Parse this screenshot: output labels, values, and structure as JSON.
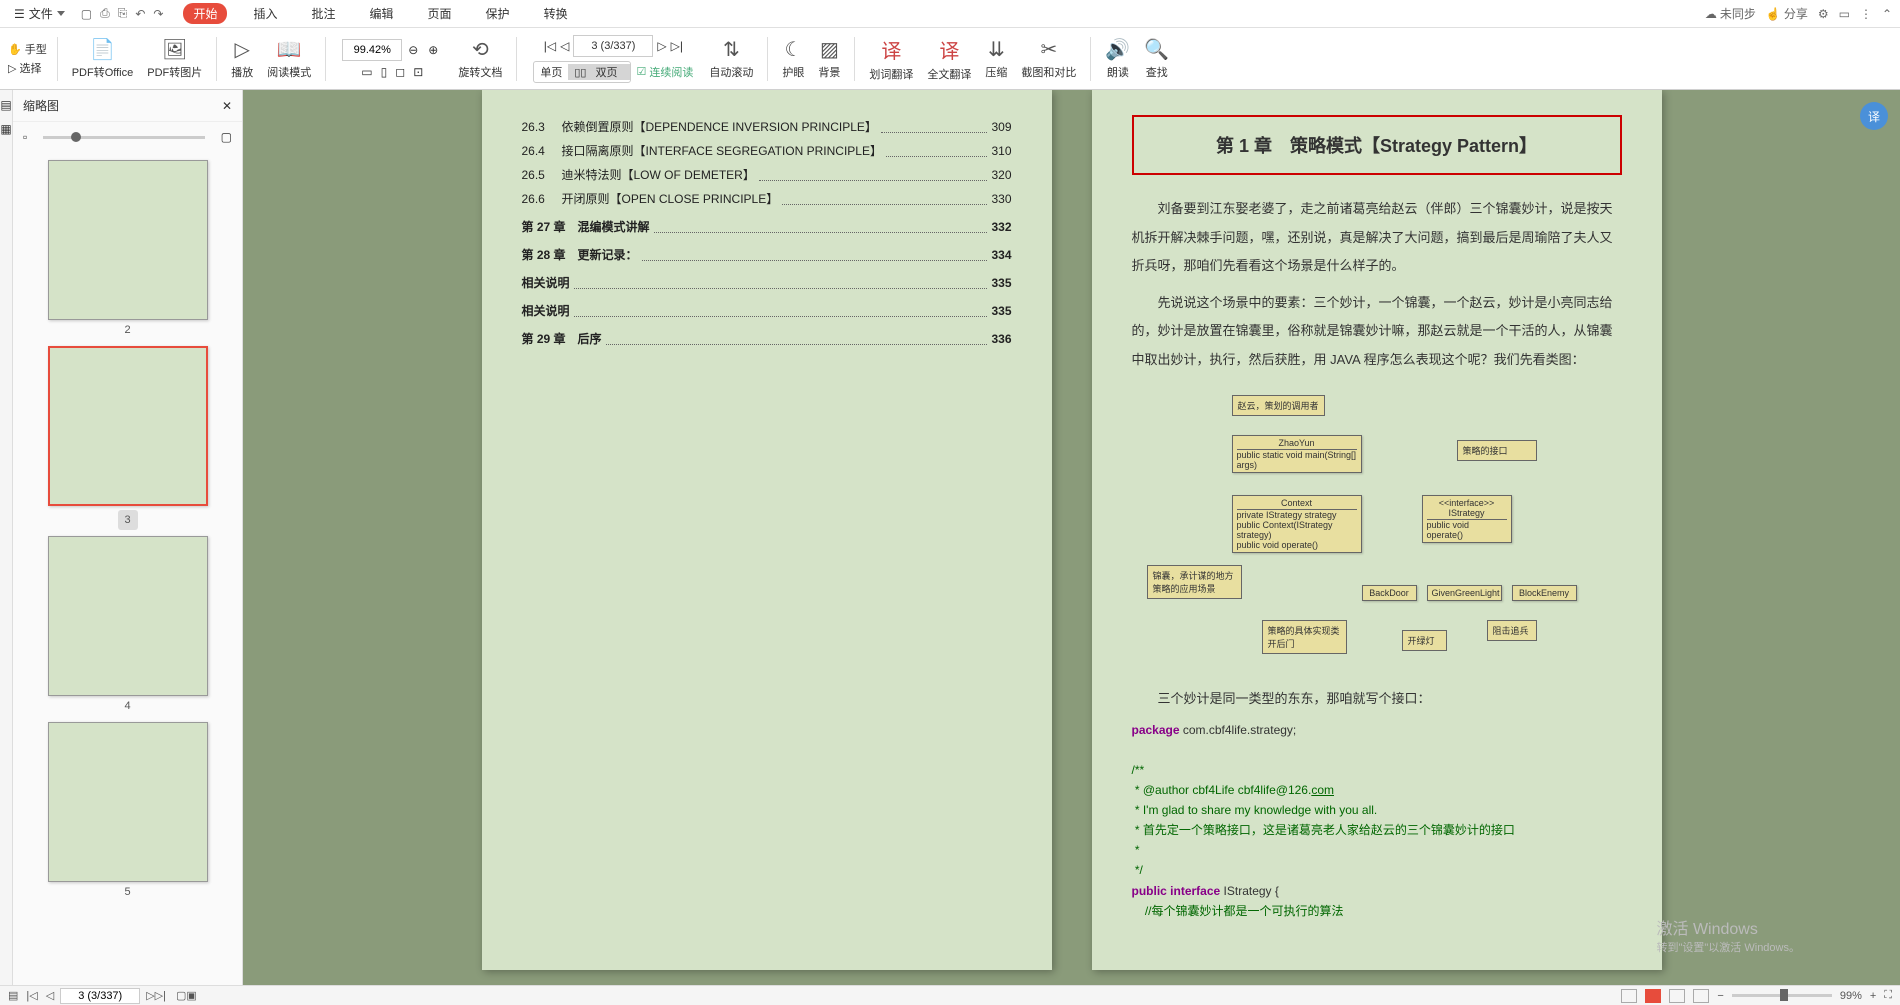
{
  "menu": {
    "file": "文件",
    "tabs": [
      "开始",
      "插入",
      "批注",
      "编辑",
      "页面",
      "保护",
      "转换"
    ]
  },
  "topright": {
    "sync": "未同步",
    "share": "分享"
  },
  "sidebar": {
    "hand": "手型",
    "select": "选择"
  },
  "tb": {
    "pdf_office": "PDF转Office",
    "pdf_img": "PDF转图片",
    "play": "播放",
    "read_mode": "阅读模式",
    "zoom": "99.42%",
    "page_info": "3 (3/337)",
    "rotate": "旋转文档",
    "single": "单页",
    "double": "双页",
    "cont_read": "连续阅读",
    "auto_scroll": "自动滚动",
    "bg": "背景",
    "word_trans": "划词翻译",
    "full_trans": "全文翻译",
    "compress": "压缩",
    "compare": "截图和对比",
    "read_aloud": "朗读",
    "find": "查找",
    "eye": "护眼"
  },
  "thumbs": {
    "title": "缩略图",
    "pages": [
      "2",
      "3",
      "4",
      "5"
    ]
  },
  "toc": {
    "items": [
      {
        "n": "26.3",
        "t": "依赖倒置原则【DEPENDENCE INVERSION PRINCIPLE】",
        "p": "309"
      },
      {
        "n": "26.4",
        "t": "接口隔离原则【INTERFACE SEGREGATION PRINCIPLE】",
        "p": "310"
      },
      {
        "n": "26.5",
        "t": "迪米特法则【LOW OF DEMETER】",
        "p": "320"
      },
      {
        "n": "26.6",
        "t": "开闭原则【OPEN CLOSE PRINCIPLE】",
        "p": "330"
      }
    ],
    "chapters": [
      {
        "t": "第 27 章　混编模式讲解",
        "p": "332"
      },
      {
        "t": "第 28 章　更新记录：",
        "p": "334"
      },
      {
        "t": "相关说明",
        "p": "335"
      },
      {
        "t": "相关说明",
        "p": "335"
      },
      {
        "t": "第 29 章　后序",
        "p": "336"
      }
    ]
  },
  "chapter": {
    "title": "第 1 章　策略模式【Strategy Pattern】",
    "p1": "刘备要到江东娶老婆了，走之前诸葛亮给赵云（伴郎）三个锦囊妙计，说是按天机拆开解决棘手问题，嘿，还别说，真是解决了大问题，搞到最后是周瑜陪了夫人又折兵呀，那咱们先看看这个场景是什么样子的。",
    "p2": "先说说这个场景中的要素：三个妙计，一个锦囊，一个赵云，妙计是小亮同志给的，妙计是放置在锦囊里，俗称就是锦囊妙计嘛，那赵云就是一个干活的人，从锦囊中取出妙计，执行，然后获胜，用 JAVA 程序怎么表现这个呢？我们先看类图：",
    "p3": "三个妙计是同一类型的东东，那咱就写个接口：",
    "uml": {
      "note1": "赵云，策划的调用者",
      "zhaoyun": "ZhaoYun",
      "zhaoyun_m": "public static void main(String[] args)",
      "note2": "策略的接口",
      "context": "Context",
      "context_m1": "private IStrategy strategy",
      "context_m2": "public Context(IStrategy strategy)",
      "context_m3": "public void operate()",
      "istrategy": "<<interface>>\nIStrategy",
      "istrategy_m": "public void operate()",
      "note3": "锦囊，承计谋的地方\n策略的应用场景",
      "backdoor": "BackDoor",
      "green": "GivenGreenLight",
      "block": "BlockEnemy",
      "note4": "策略的具体实现类\n开后门",
      "note5": "开绿灯",
      "note6": "阻击追兵"
    },
    "code": {
      "l1": "package",
      "l1b": " com.cbf4life.strategy;",
      "l2": "/**",
      "l3": " * @author cbf4Life cbf4life@126.",
      "l3b": "com",
      "l4": " * I'm glad to share my knowledge with you all.",
      "l5": " * 首先定一个策略接口，这是诸葛亮老人家给赵云的三个锦囊妙计的接口",
      "l6": " *",
      "l7": " */",
      "l8a": "public",
      "l8b": " interface",
      "l8c": " IStrategy {",
      "l9": "    //每个锦囊妙计都是一个可执行的算法"
    }
  },
  "status": {
    "page": "3 (3/337)",
    "zoom": "99%"
  },
  "watermark": {
    "t1": "激活 Windows",
    "t2": "转到\"设置\"以激活 Windows。"
  }
}
